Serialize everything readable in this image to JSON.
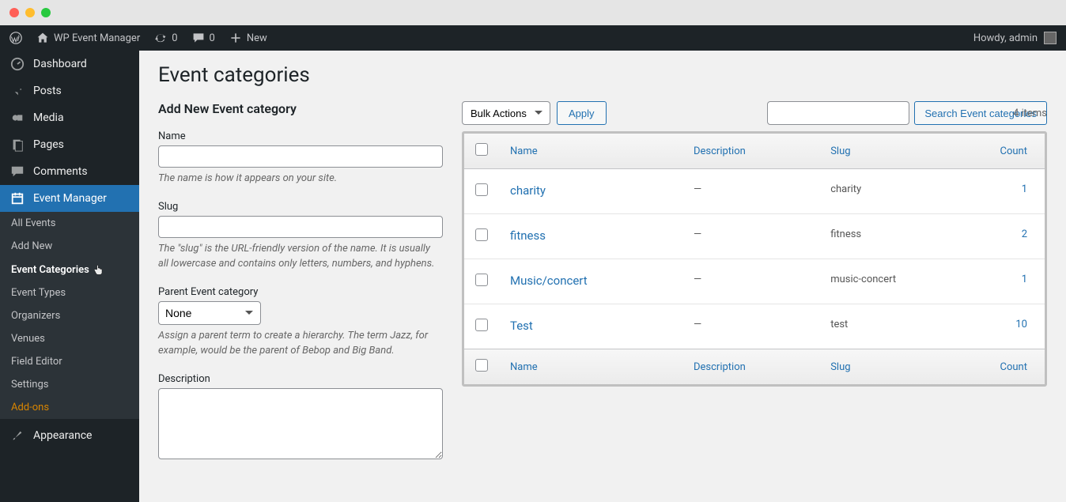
{
  "adminbar": {
    "site_title": "WP Event Manager",
    "updates": "0",
    "comments": "0",
    "new": "New",
    "greeting": "Howdy, admin"
  },
  "sidebar": {
    "dashboard": "Dashboard",
    "posts": "Posts",
    "media": "Media",
    "pages": "Pages",
    "comments": "Comments",
    "event_manager": "Event Manager",
    "appearance": "Appearance",
    "sub": {
      "all_events": "All Events",
      "add_new": "Add New",
      "event_categories": "Event Categories",
      "event_types": "Event Types",
      "organizers": "Organizers",
      "venues": "Venues",
      "field_editor": "Field Editor",
      "settings": "Settings",
      "addons": "Add-ons"
    }
  },
  "page": {
    "title": "Event categories",
    "search_button": "Search Event categories",
    "items_count": "4 items"
  },
  "form": {
    "heading": "Add New Event category",
    "name_label": "Name",
    "name_help": "The name is how it appears on your site.",
    "slug_label": "Slug",
    "slug_help": "The \"slug\" is the URL-friendly version of the name. It is usually all lowercase and contains only letters, numbers, and hyphens.",
    "parent_label": "Parent Event category",
    "parent_none": "None",
    "parent_help": "Assign a parent term to create a hierarchy. The term Jazz, for example, would be the parent of Bebop and Big Band.",
    "description_label": "Description"
  },
  "bulk": {
    "label": "Bulk Actions",
    "apply": "Apply"
  },
  "columns": {
    "name": "Name",
    "description": "Description",
    "slug": "Slug",
    "count": "Count"
  },
  "rows": [
    {
      "name": "charity",
      "description": "—",
      "slug": "charity",
      "count": "1"
    },
    {
      "name": "fitness",
      "description": "—",
      "slug": "fitness",
      "count": "2"
    },
    {
      "name": "Music/concert",
      "description": "—",
      "slug": "music-concert",
      "count": "1"
    },
    {
      "name": "Test",
      "description": "—",
      "slug": "test",
      "count": "10"
    }
  ]
}
